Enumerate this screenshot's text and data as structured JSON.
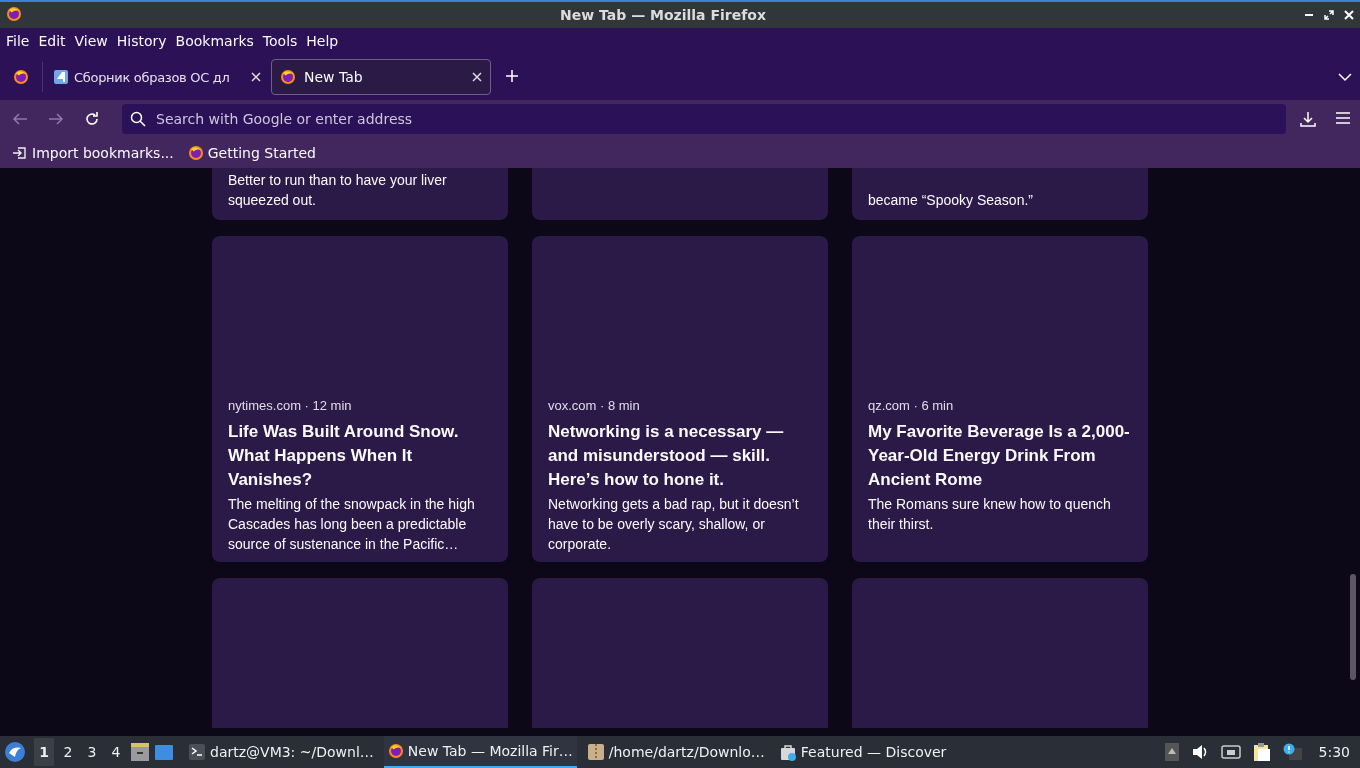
{
  "window": {
    "title": "New Tab — Mozilla Firefox"
  },
  "menu": [
    "File",
    "Edit",
    "View",
    "History",
    "Bookmarks",
    "Tools",
    "Help"
  ],
  "tabs": [
    {
      "title": "Сборник образов ОС дл",
      "kind": "site",
      "selected": false
    },
    {
      "title": "New Tab",
      "kind": "newtab",
      "selected": true
    }
  ],
  "address_bar": {
    "placeholder": "Search with Google or enter address"
  },
  "bookmarks": [
    {
      "label": "Import bookmarks...",
      "kind": "import"
    },
    {
      "label": "Getting Started",
      "kind": "bookmark"
    }
  ],
  "stories": [
    {
      "kind": "partial",
      "excerpt": "Better to run than to have your liver squeezed out."
    },
    {
      "kind": "partial"
    },
    {
      "kind": "partial",
      "excerpt": "became “Spooky Season.”"
    },
    {
      "kind": "full",
      "source": "nytimes.com · 12 min",
      "title": "Life Was Built Around Snow. What Happens When It Vanishes?",
      "excerpt": "The melting of the snowpack in the high Cascades has long been a predictable source of sustenance in the Pacific…"
    },
    {
      "kind": "full",
      "source": "vox.com · 8 min",
      "title": "Networking is a necessary — and misunderstood — skill. Here’s how to hone it.",
      "excerpt": "Networking gets a bad rap, but it doesn’t have to be overly scary, shallow, or corporate."
    },
    {
      "kind": "full",
      "source": "qz.com · 6 min",
      "title": "My Favorite Beverage Is a 2,000-Year-Old Energy Drink From Ancient Rome",
      "excerpt": "The Romans sure knew how to quench their thirst."
    },
    {
      "kind": "empty"
    },
    {
      "kind": "empty"
    },
    {
      "kind": "empty"
    }
  ],
  "taskbar": {
    "workspaces": [
      {
        "label": "1",
        "selected": true
      },
      {
        "label": "2",
        "selected": false
      },
      {
        "label": "3",
        "selected": false
      },
      {
        "label": "4",
        "selected": false
      }
    ],
    "tasks": [
      {
        "title": "dartz@VM3: ~/Downl…",
        "selected": false
      },
      {
        "title": "New Tab — Mozilla Fir…",
        "selected": true
      },
      {
        "title": "/home/dartz/Downlo…",
        "selected": false
      },
      {
        "title": "Featured — Discover",
        "selected": false
      }
    ],
    "clock": "5:30"
  }
}
